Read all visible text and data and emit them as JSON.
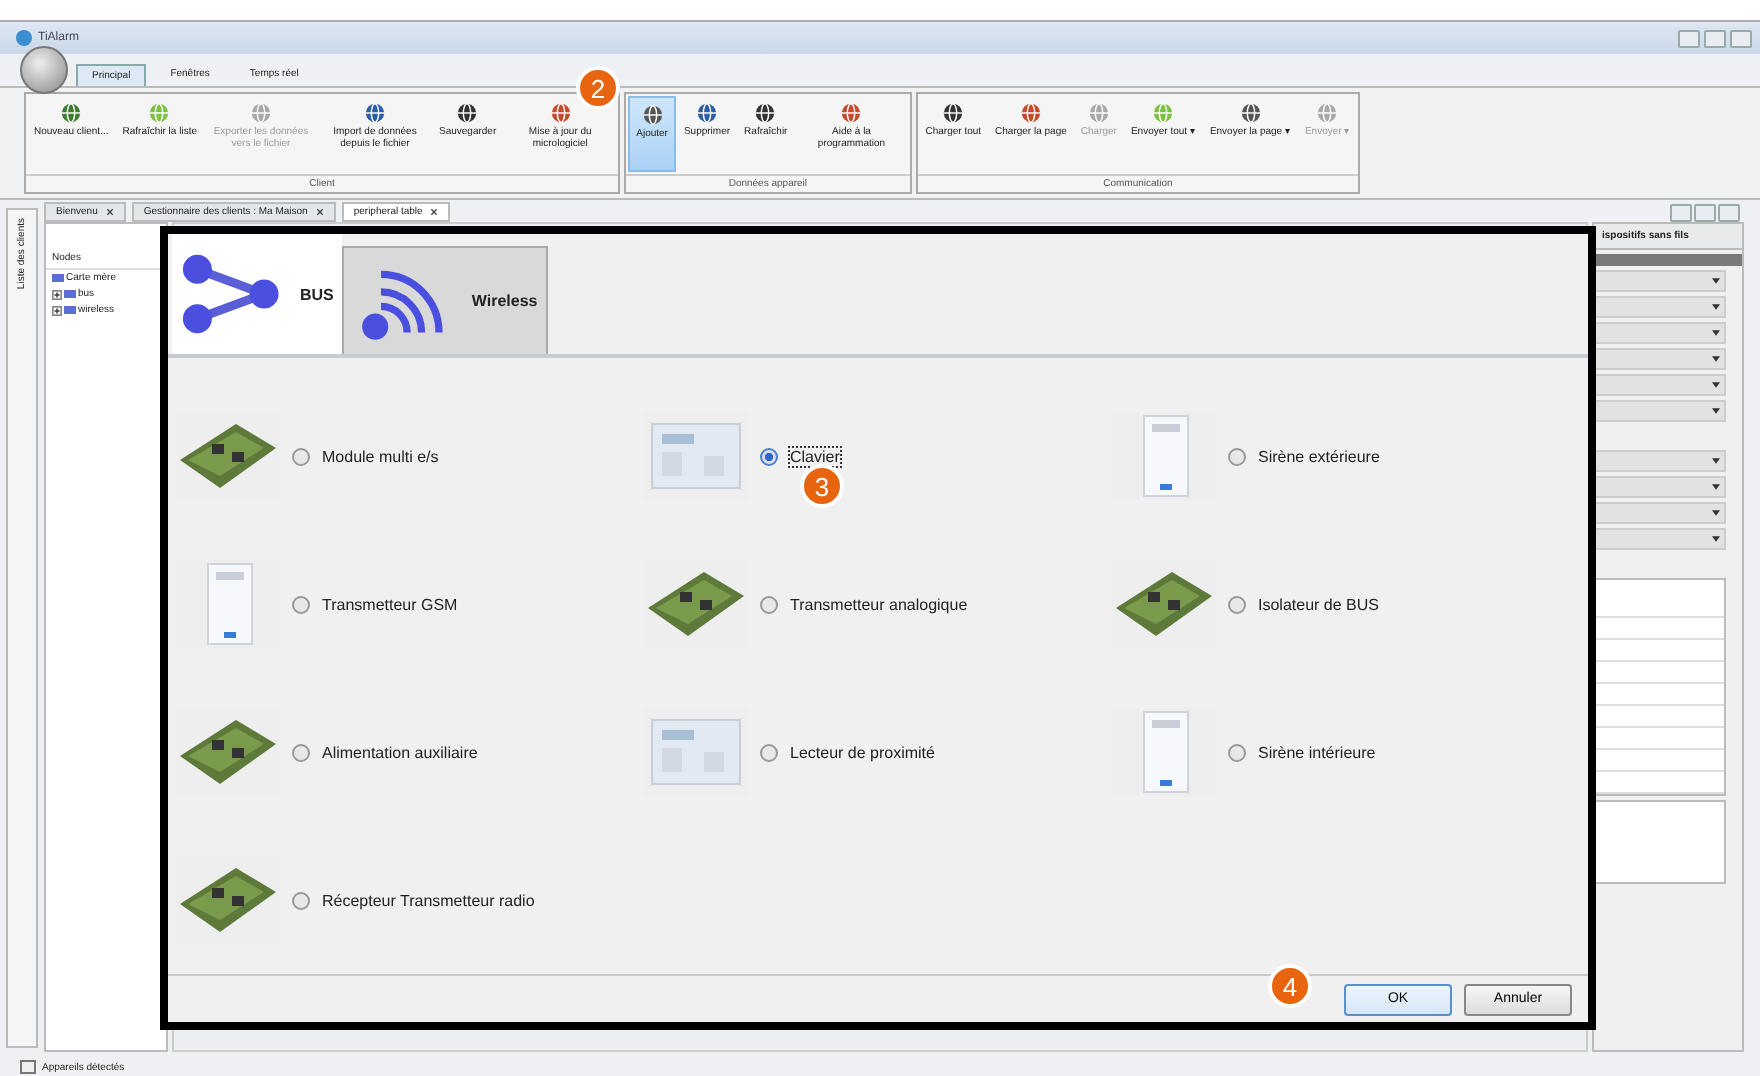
{
  "window": {
    "title": "TiAlarm"
  },
  "ribbon_tabs": [
    {
      "label": "Principal",
      "selected": true
    },
    {
      "label": "Fenêtres",
      "selected": false
    },
    {
      "label": "Temps réel",
      "selected": false
    }
  ],
  "ribbon_groups": [
    {
      "caption": "Client",
      "buttons": [
        {
          "label": "Nouveau client...",
          "disabled": false,
          "selected": false
        },
        {
          "label": "Rafraîchir la liste",
          "disabled": false,
          "selected": false
        },
        {
          "label": "Exporter les données vers le fichier",
          "disabled": true,
          "selected": false
        },
        {
          "label": "Import de données depuis le fichier",
          "disabled": false,
          "selected": false
        },
        {
          "label": "Sauvegarder",
          "disabled": false,
          "selected": false
        },
        {
          "label": "Mise à jour du micrologiciel",
          "disabled": false,
          "selected": false
        }
      ]
    },
    {
      "caption": "Données appareil",
      "buttons": [
        {
          "label": "Ajouter",
          "disabled": false,
          "selected": true
        },
        {
          "label": "Supprimer",
          "disabled": false,
          "selected": false
        },
        {
          "label": "Rafraîchir",
          "disabled": false,
          "selected": false
        },
        {
          "label": "Aide à la programmation",
          "disabled": false,
          "selected": false
        }
      ]
    },
    {
      "caption": "Communication",
      "buttons": [
        {
          "label": "Charger tout",
          "disabled": false,
          "selected": false
        },
        {
          "label": "Charger la page",
          "disabled": false,
          "selected": false
        },
        {
          "label": "Charger",
          "disabled": true,
          "selected": false
        },
        {
          "label": "Envoyer tout ▾",
          "disabled": false,
          "selected": false
        },
        {
          "label": "Envoyer la page ▾",
          "disabled": false,
          "selected": false
        },
        {
          "label": "Envoyer ▾",
          "disabled": true,
          "selected": false
        }
      ]
    }
  ],
  "document_tabs": [
    {
      "label": "Bienvenu",
      "selected": false
    },
    {
      "label": "Gestionnaire des clients : Ma Maison",
      "selected": false
    },
    {
      "label": "peripheral table",
      "selected": true
    }
  ],
  "sidebar": {
    "label": "Liste des clients"
  },
  "tree": {
    "header": "Nodes",
    "items": [
      {
        "label": "Carte mère"
      },
      {
        "label": "bus",
        "expanded": false
      },
      {
        "label": "wireless",
        "expanded": false
      }
    ]
  },
  "right_panel": {
    "title": "ispositifs sans fils"
  },
  "dialog": {
    "tabs": [
      {
        "label": "BUS",
        "selected": true
      },
      {
        "label": "Wireless",
        "selected": false
      }
    ],
    "devices": [
      {
        "label": "Module multi e/s",
        "selected": false
      },
      {
        "label": "Clavier",
        "selected": true
      },
      {
        "label": "Sirène extérieure",
        "selected": false
      },
      {
        "label": "Transmetteur GSM",
        "selected": false
      },
      {
        "label": "Transmetteur analogique",
        "selected": false
      },
      {
        "label": "Isolateur de BUS",
        "selected": false
      },
      {
        "label": "Alimentation auxiliaire",
        "selected": false
      },
      {
        "label": "Lecteur de proximité",
        "selected": false
      },
      {
        "label": "Sirène intérieure",
        "selected": false
      },
      {
        "label": "Récepteur Transmetteur radio",
        "selected": false
      }
    ],
    "buttons": [
      "OK",
      "Annuler"
    ]
  },
  "callouts": [
    "2",
    "3",
    "4"
  ],
  "status_bar": {
    "text": "Appareils détectés"
  }
}
